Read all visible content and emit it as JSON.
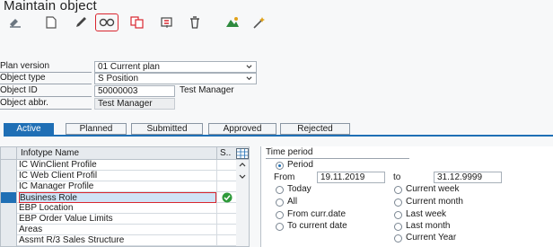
{
  "title": "Maintain object",
  "toolbar": {
    "icons": [
      "display-icon",
      "create-icon",
      "change-icon",
      "overview-icon",
      "copy-icon",
      "delimit-icon",
      "delete-icon",
      "structure-icon",
      "wand-icon"
    ],
    "highlight_color": "#d9262f"
  },
  "form": {
    "plan_version": {
      "label": "Plan version",
      "value": "01 Current plan"
    },
    "object_type": {
      "label": "Object type",
      "value": "S Position"
    },
    "object_id": {
      "label": "Object ID",
      "value": "50000003",
      "description": "Test Manager"
    },
    "object_abbr": {
      "label": "Object abbr.",
      "value": "Test Manager"
    }
  },
  "tabs": [
    "Active",
    "Planned",
    "Submitted",
    "Approved",
    "Rejected"
  ],
  "grid": {
    "col_name": "Infotype Name",
    "col_status": "S..",
    "rows": [
      "IC WinClient Profile",
      "IC Web Client Profil",
      "IC Manager Profile",
      "Business Role",
      "EBP Location",
      "EBP Order Value Limits",
      "Areas",
      "Assmt R/3 Sales Structure"
    ],
    "selected_index": 3
  },
  "time_period": {
    "title": "Time period",
    "period_label": "Period",
    "from_label": "From",
    "from_value": "19.11.2019",
    "to_label": "to",
    "to_value": "31.12.9999",
    "left_options": [
      "Today",
      "All",
      "From curr.date",
      "To current date"
    ],
    "right_options": [
      "Current week",
      "Current month",
      "Last week",
      "Last month",
      "Current Year"
    ]
  },
  "colors": {
    "accent": "#1f6fb5",
    "ok": "#2e9a3a"
  }
}
